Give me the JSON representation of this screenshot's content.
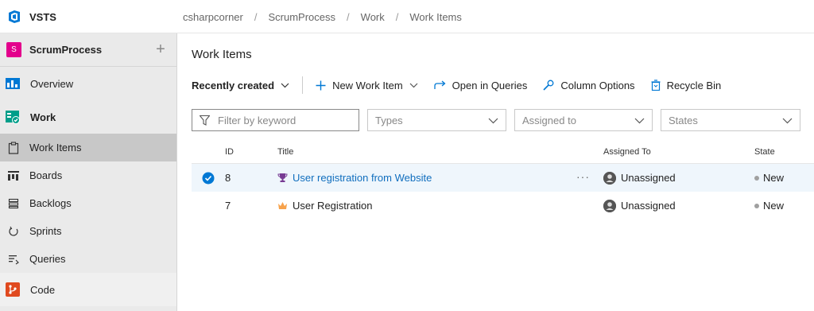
{
  "app": {
    "name": "VSTS"
  },
  "breadcrumb": [
    "csharpcorner",
    "ScrumProcess",
    "Work",
    "Work Items"
  ],
  "breadcrumb_separator": "/",
  "project": {
    "initial": "S",
    "name": "ScrumProcess",
    "avatar_color": "#e3008c",
    "add_glyph": "+"
  },
  "sidebar": {
    "overview": "Overview",
    "work": "Work",
    "sub": [
      {
        "label": "Work Items",
        "icon": "clipboard-icon",
        "active": true
      },
      {
        "label": "Boards",
        "icon": "board-icon"
      },
      {
        "label": "Backlogs",
        "icon": "backlog-icon"
      },
      {
        "label": "Sprints",
        "icon": "sprint-icon"
      },
      {
        "label": "Queries",
        "icon": "query-icon"
      }
    ],
    "code": "Code"
  },
  "main": {
    "title": "Work Items",
    "toolbar": {
      "view": "Recently created",
      "new_item": "New Work Item",
      "open_queries": "Open in Queries",
      "column_options": "Column Options",
      "recycle_bin": "Recycle Bin"
    },
    "filters": {
      "keyword_placeholder": "Filter by keyword",
      "types": "Types",
      "assigned_to": "Assigned to",
      "states": "States"
    },
    "grid": {
      "headers": {
        "id": "ID",
        "title": "Title",
        "assigned": "Assigned To",
        "state": "State"
      },
      "rows": [
        {
          "id": "8",
          "title": "User registration from Website",
          "type_icon": "trophy-icon",
          "assigned": "Unassigned",
          "state": "New",
          "selected": true,
          "more": "···"
        },
        {
          "id": "7",
          "title": "User Registration",
          "type_icon": "crown-icon",
          "assigned": "Unassigned",
          "state": "New",
          "selected": false
        }
      ]
    }
  },
  "colors": {
    "accent": "#0078d4",
    "link": "#106ebe",
    "selected_row": "#eff6fc",
    "trophy": "#773b93",
    "crown": "#f7a24b"
  }
}
